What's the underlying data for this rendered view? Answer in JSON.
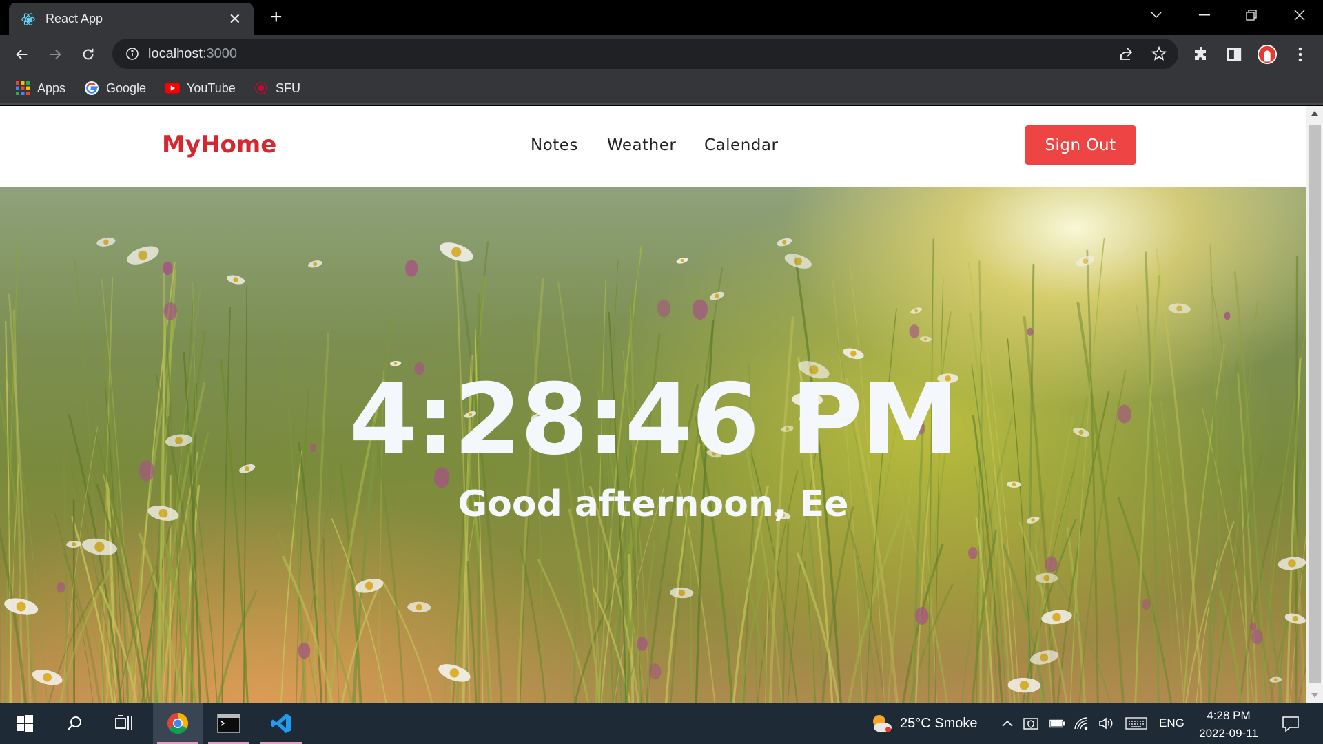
{
  "browser": {
    "tab_title": "React App",
    "url_host": "localhost",
    "url_port": ":3000",
    "bookmarks": [
      {
        "label": "Apps",
        "icon": "apps-grid-icon"
      },
      {
        "label": "Google",
        "icon": "google-icon"
      },
      {
        "label": "YouTube",
        "icon": "youtube-icon"
      },
      {
        "label": "SFU",
        "icon": "sfu-icon"
      }
    ]
  },
  "app": {
    "brand": "MyHome",
    "nav": [
      "Notes",
      "Weather",
      "Calendar"
    ],
    "sign_out_label": "Sign Out",
    "clock": "4:28:46 PM",
    "greeting": "Good afternoon, Ee",
    "accent_color": "#ef4444",
    "brand_color": "#d7262e"
  },
  "taskbar": {
    "weather": "25°C  Smoke",
    "language": "ENG",
    "time": "4:28 PM",
    "date": "2022-09-11"
  }
}
